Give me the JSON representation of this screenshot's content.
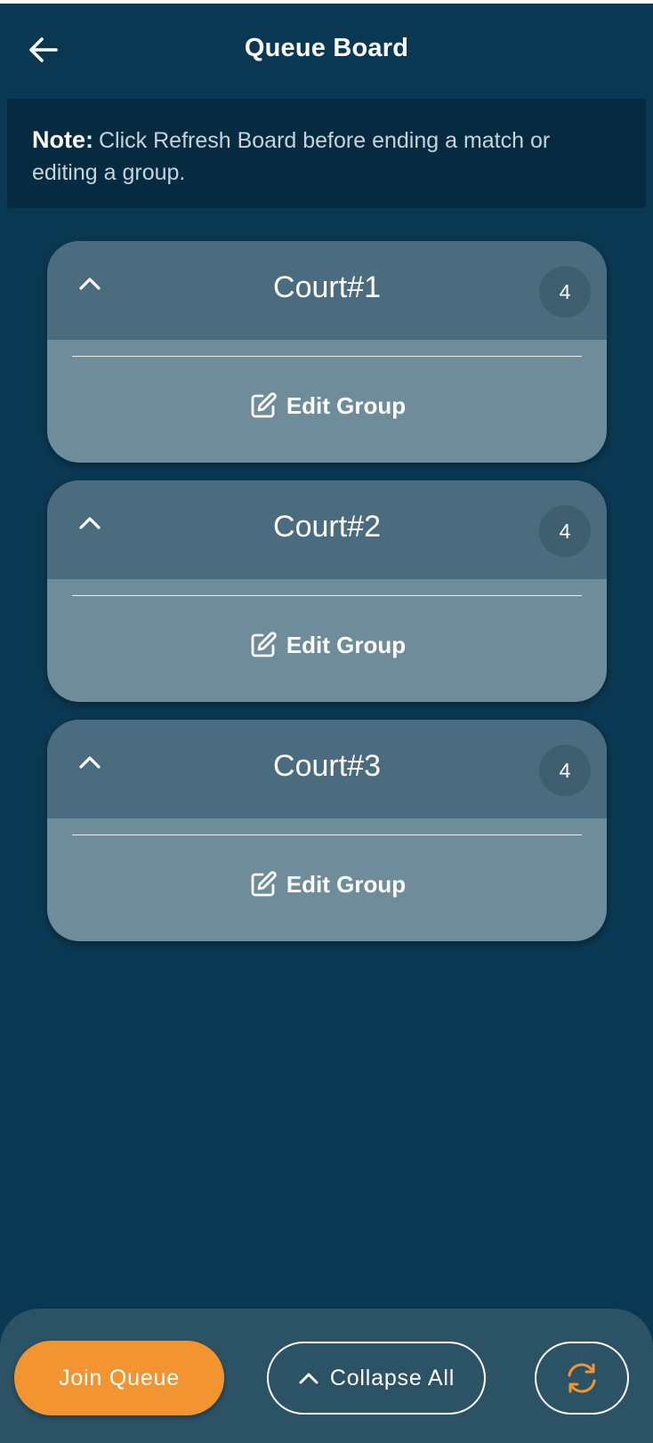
{
  "header": {
    "title": "Queue Board",
    "back_icon": "arrow-left-icon"
  },
  "note": {
    "label": "Note:",
    "text": "Click Refresh Board before ending a match or editing a group."
  },
  "courts": [
    {
      "name": "Court#1",
      "count": "4",
      "edit_label": "Edit Group"
    },
    {
      "name": "Court#2",
      "count": "4",
      "edit_label": "Edit Group"
    },
    {
      "name": "Court#3",
      "count": "4",
      "edit_label": "Edit Group"
    }
  ],
  "footer": {
    "join_label": "Join Queue",
    "collapse_label": "Collapse All",
    "refresh_icon": "refresh-icon"
  },
  "colors": {
    "background": "#0a3852",
    "note_bg": "#062b40",
    "card_header": "#4a6c7e",
    "card_body": "#6e8c99",
    "accent": "#f29531",
    "bottom_bar": "#2c5266"
  }
}
